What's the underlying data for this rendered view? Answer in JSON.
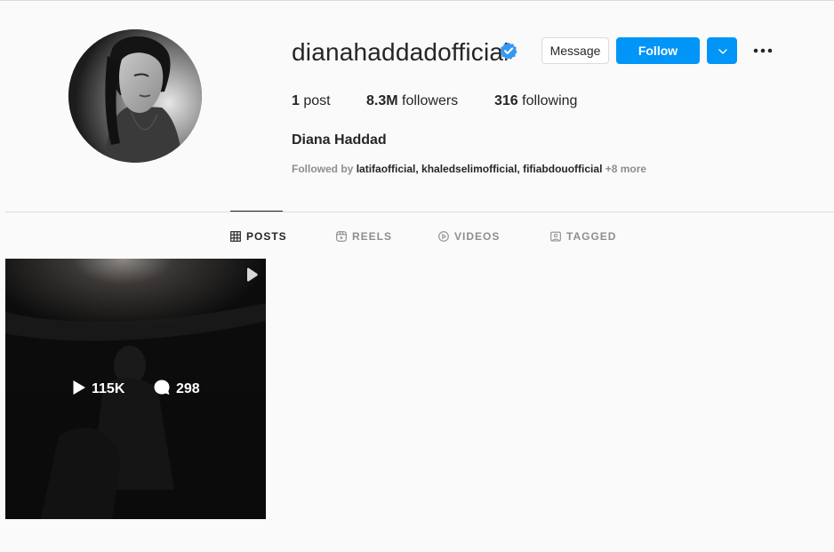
{
  "profile": {
    "username": "dianahaddadofficial",
    "verified": true,
    "full_name": "Diana Haddad",
    "followed_by_prefix": "Followed by",
    "followed_by_names": "latifaofficial, khaledselimofficial, fifiabdouofficial",
    "followed_by_more": "+8 more"
  },
  "actions": {
    "message_label": "Message",
    "follow_label": "Follow"
  },
  "stats": {
    "posts_count": "1",
    "posts_label": "post",
    "followers_count": "8.3M",
    "followers_label": "followers",
    "following_count": "316",
    "following_label": "following"
  },
  "tabs": [
    {
      "label": "POSTS",
      "icon": "grid-icon",
      "active": true
    },
    {
      "label": "REELS",
      "icon": "reels-icon",
      "active": false
    },
    {
      "label": "VIDEOS",
      "icon": "video-icon",
      "active": false
    },
    {
      "label": "TAGGED",
      "icon": "tagged-icon",
      "active": false
    }
  ],
  "posts": [
    {
      "type": "reel",
      "plays": "115K",
      "comments": "298"
    }
  ],
  "colors": {
    "accent": "#0095f6",
    "verified": "#3897f0",
    "text": "#262626",
    "muted": "#8e8e8e",
    "border": "#dbdbdb",
    "background": "#fafafa"
  }
}
